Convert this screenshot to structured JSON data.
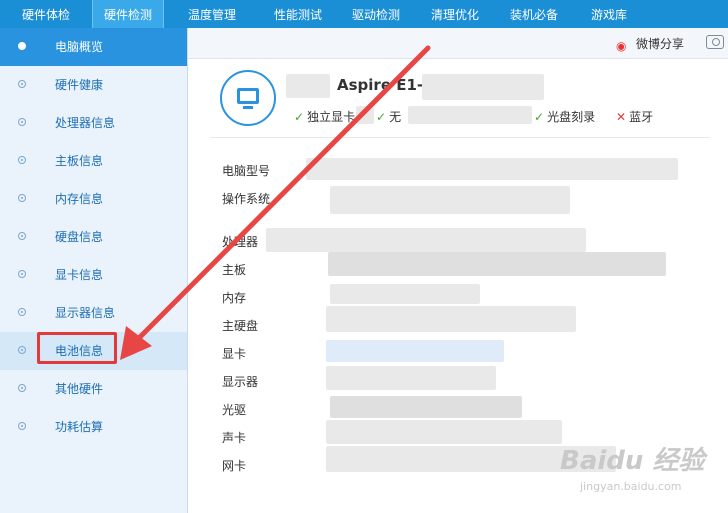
{
  "topnav": {
    "tabs": [
      "硬件体检",
      "硬件检测",
      "温度管理",
      "性能测试",
      "驱动检测",
      "清理优化",
      "装机必备",
      "游戏库"
    ],
    "active_tab": "硬件检测"
  },
  "sidebar": {
    "items": [
      {
        "label": "电脑概览",
        "state": "active"
      },
      {
        "label": "硬件健康"
      },
      {
        "label": "处理器信息"
      },
      {
        "label": "主板信息"
      },
      {
        "label": "内存信息"
      },
      {
        "label": "硬盘信息"
      },
      {
        "label": "显卡信息"
      },
      {
        "label": "显示器信息"
      },
      {
        "label": "电池信息",
        "state": "highlighted"
      },
      {
        "label": "其他硬件"
      },
      {
        "label": "功耗估算"
      }
    ]
  },
  "subbar": {
    "share_label": "微博分享",
    "weibo_icon": "weibo-icon",
    "camera_icon": "camera-icon"
  },
  "summary": {
    "model_text": "Aspire E1-",
    "features": [
      {
        "mark": "check",
        "label": "独立显卡"
      },
      {
        "mark": "check",
        "label": "无"
      },
      {
        "mark": "check",
        "label": "光盘刻录"
      },
      {
        "mark": "cross",
        "label": "蓝牙"
      }
    ]
  },
  "details": {
    "labels": [
      "电脑型号",
      "操作系统",
      "处理器",
      "主板",
      "内存",
      "主硬盘",
      "显卡",
      "显示器",
      "光驱",
      "声卡",
      "网卡"
    ]
  },
  "watermark": {
    "logo": "Baidu 经验",
    "url": "jingyan.baidu.com"
  },
  "colors": {
    "nav_blue": "#1b8fd6",
    "active_blue": "#2a93e0",
    "annotation_red": "#e23a3a",
    "check_green": "#4aa52d"
  }
}
